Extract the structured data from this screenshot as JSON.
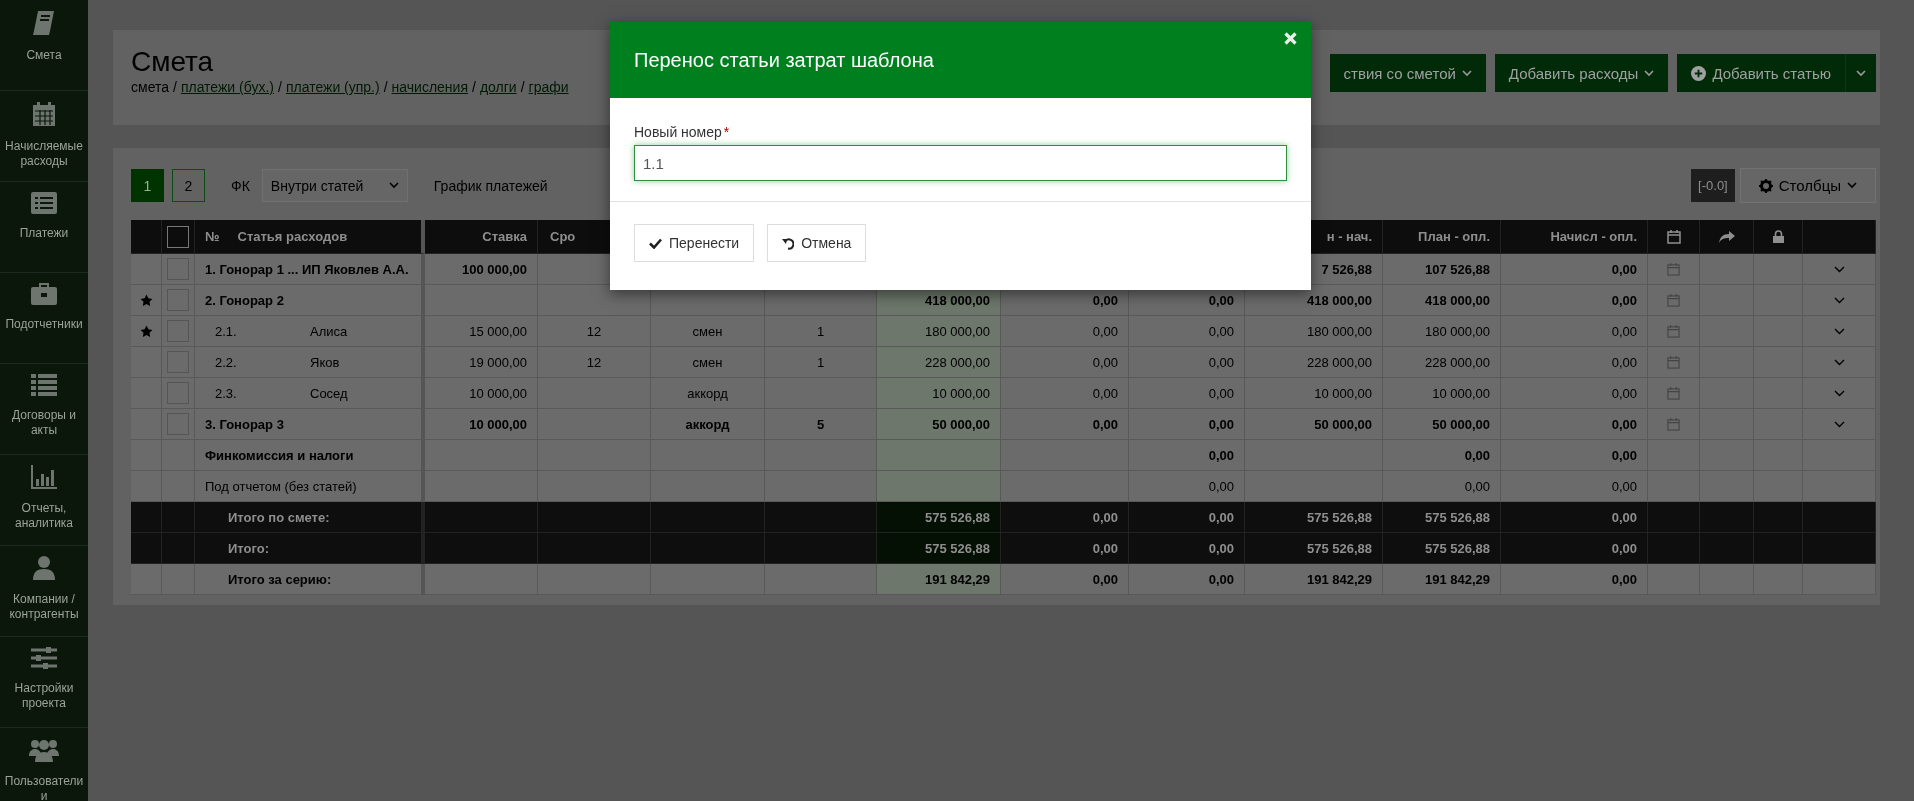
{
  "sidebar": {
    "items": [
      {
        "label": "Смета"
      },
      {
        "label": "Начисляемые расходы"
      },
      {
        "label": "Платежи"
      },
      {
        "label": "Подотчетники"
      },
      {
        "label": "Договоры и акты"
      },
      {
        "label": "Отчеты, аналитика"
      },
      {
        "label": "Компании / контрагенты"
      },
      {
        "label": "Настройки проекта"
      },
      {
        "label": "Пользователи и"
      }
    ]
  },
  "header": {
    "title": "Смета",
    "breadcrumb_separator": "/",
    "breadcrumb": [
      {
        "label": "смета",
        "link": false
      },
      {
        "label": "платежи (бух.)",
        "link": true
      },
      {
        "label": "платежи (упр.)",
        "link": true
      },
      {
        "label": "начисления",
        "link": true
      },
      {
        "label": "долги",
        "link": true
      },
      {
        "label": "графи",
        "link": true
      }
    ],
    "buttons": [
      {
        "label": "ствия со сметой",
        "kind": "dropdown"
      },
      {
        "label": "Добавить расходы",
        "kind": "dropdown"
      },
      {
        "label": "Добавить статью",
        "kind": "add-split"
      }
    ]
  },
  "toolbar": {
    "pages": [
      {
        "label": "1",
        "selected": true
      },
      {
        "label": "2",
        "selected": false
      }
    ],
    "fk_label": "ФК",
    "fk_select": "Внутри статей",
    "schedule_label": "График платежей",
    "balance": "[-0.0]",
    "columns_button": "Столбцы"
  },
  "table": {
    "number_label": "№",
    "name_label": "Статья расходов",
    "select_all_checked": false,
    "columns": [
      "Ставка",
      "Сро",
      null,
      null,
      null,
      null,
      null,
      "н - нач.",
      "План - опл.",
      "Начисл - опл."
    ],
    "rows": [
      {
        "kind": "group",
        "starred": false,
        "checked": false,
        "name": "1. Гонорар 1 ... ИП Яковлев А.А.",
        "cells": [
          "100 000,00",
          null,
          null,
          null,
          null,
          null,
          null,
          "7 526,88",
          "107 526,88",
          "0,00"
        ],
        "calendar": true,
        "expand": true
      },
      {
        "kind": "group",
        "starred": true,
        "checked": false,
        "name": "2. Гонорар 2",
        "cells": [
          null,
          null,
          null,
          null,
          "418 000,00",
          "0,00",
          "0,00",
          "418 000,00",
          "418 000,00",
          "0,00"
        ],
        "calendar": true,
        "expand": true
      },
      {
        "kind": "item",
        "starred": true,
        "checked": false,
        "number": "2.1.",
        "name": "Алиса",
        "cells": [
          "15 000,00",
          "12",
          "смен",
          "1",
          "180 000,00",
          "0,00",
          "0,00",
          "180 000,00",
          "180 000,00",
          "0,00"
        ],
        "calendar": true,
        "expand": true
      },
      {
        "kind": "item",
        "starred": false,
        "checked": false,
        "number": "2.2.",
        "name": "Яков",
        "cells": [
          "19 000,00",
          "12",
          "смен",
          "1",
          "228 000,00",
          "0,00",
          "0,00",
          "228 000,00",
          "228 000,00",
          "0,00"
        ],
        "calendar": true,
        "expand": true
      },
      {
        "kind": "item",
        "starred": false,
        "checked": false,
        "number": "2.3.",
        "name": "Сосед",
        "cells": [
          "10 000,00",
          null,
          "аккорд",
          null,
          "10 000,00",
          "0,00",
          "0,00",
          "10 000,00",
          "10 000,00",
          "0,00"
        ],
        "calendar": true,
        "expand": true
      },
      {
        "kind": "group",
        "starred": false,
        "checked": false,
        "name": "3. Гонорар 3",
        "cells": [
          "10 000,00",
          null,
          "аккорд",
          "5",
          "50 000,00",
          "0,00",
          "0,00",
          "50 000,00",
          "50 000,00",
          "0,00"
        ],
        "calendar": true,
        "expand": true
      },
      {
        "kind": "group",
        "starred": false,
        "name": "Финкомиссия и налоги",
        "cells": [
          null,
          null,
          null,
          null,
          null,
          null,
          "0,00",
          null,
          "0,00",
          "0,00"
        ],
        "calendar": false,
        "expand": false
      },
      {
        "kind": "note",
        "starred": false,
        "name": "Под отчетом (без статей)",
        "cells": [
          null,
          null,
          null,
          null,
          null,
          null,
          "0,00",
          null,
          "0,00",
          "0,00"
        ],
        "calendar": false,
        "expand": false
      },
      {
        "kind": "total",
        "starred": false,
        "name": "Итого по смете:",
        "cells": [
          null,
          null,
          null,
          null,
          "575 526,88",
          "0,00",
          "0,00",
          "575 526,88",
          "575 526,88",
          "0,00"
        ],
        "calendar": false,
        "expand": false
      },
      {
        "kind": "total",
        "starred": false,
        "name": "Итого:",
        "cells": [
          null,
          null,
          null,
          null,
          "575 526,88",
          "0,00",
          "0,00",
          "575 526,88",
          "575 526,88",
          "0,00"
        ],
        "calendar": false,
        "expand": false
      },
      {
        "kind": "series_total",
        "starred": false,
        "name": "Итого за серию:",
        "cells": [
          null,
          null,
          null,
          null,
          "191 842,29",
          "0,00",
          "0,00",
          "191 842,29",
          "191 842,29",
          "0,00"
        ],
        "calendar": false,
        "expand": false
      }
    ]
  },
  "modal": {
    "title": "Перенос статьи затрат шаблона",
    "field_label": "Новый номер",
    "required_mark": "*",
    "field_value": "1.1",
    "buttons": [
      {
        "label": "Перенести",
        "kind": "confirm"
      },
      {
        "label": "Отмена",
        "kind": "cancel"
      }
    ]
  }
}
